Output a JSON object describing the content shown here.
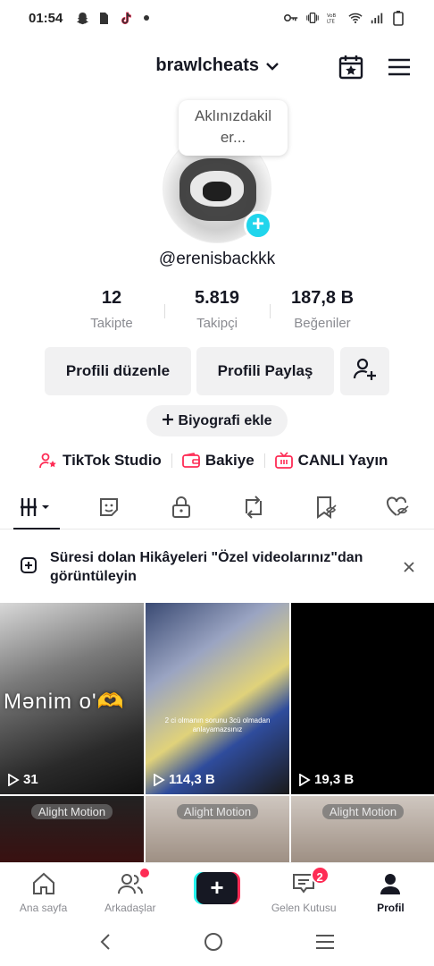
{
  "status_bar": {
    "time": "01:54",
    "left_icons": [
      "snapchat-icon",
      "sim-icon",
      "tiktok-icon",
      "dot-icon"
    ],
    "right_icons": [
      "key-icon",
      "vibrate-icon",
      "volte-icon",
      "wifi-icon",
      "signal-icon",
      "battery-icon"
    ]
  },
  "header": {
    "username": "brawlcheats",
    "icons": [
      "calendar-star-icon",
      "menu-icon"
    ]
  },
  "profile": {
    "bubble_text_line1": "Aklınızdakil",
    "bubble_text_line2": "er...",
    "handle": "@erenisbackkk",
    "stats": [
      {
        "value": "12",
        "label": "Takipte"
      },
      {
        "value": "5.819",
        "label": "Takipçi"
      },
      {
        "value": "187,8 B",
        "label": "Beğeniler"
      }
    ],
    "buttons": {
      "edit": "Profili düzenle",
      "share": "Profili Paylaş",
      "bio": "Biyografi ekle"
    },
    "links": [
      {
        "label": "TikTok Studio",
        "icon": "person-star-icon"
      },
      {
        "label": "Bakiye",
        "icon": "wallet-icon"
      },
      {
        "label": "CANLI Yayın",
        "icon": "live-tv-icon"
      }
    ]
  },
  "tabs": [
    "videos-grid-icon",
    "sticker-icon",
    "lock-icon",
    "repost-icon",
    "bookmark-hidden-icon",
    "heart-hidden-icon"
  ],
  "banner": {
    "text": "Süresi dolan Hikâyeleri \"Özel videolarınız\"dan görüntüleyin"
  },
  "videos": [
    {
      "views": "31",
      "caption": "Mənim o'🫶"
    },
    {
      "views": "114,3 B",
      "subtitle": "2 ci olmanın sorunu 3cü olmadan anlayamazsınız"
    },
    {
      "views": "19,3 B"
    },
    {
      "watermark": "Alight Motion"
    },
    {
      "watermark": "Alight Motion"
    },
    {
      "watermark": "Alight Motion"
    }
  ],
  "bottom_nav": [
    {
      "label": "Ana sayfa",
      "icon": "home-icon"
    },
    {
      "label": "Arkadaşlar",
      "icon": "friends-icon"
    },
    {
      "label": "",
      "icon": "create-icon"
    },
    {
      "label": "Gelen Kutusu",
      "icon": "inbox-icon",
      "badge": "2"
    },
    {
      "label": "Profil",
      "icon": "profile-icon"
    }
  ],
  "colors": {
    "accent": "#fe2c55",
    "cyan": "#20d5ec",
    "text": "#161823",
    "muted": "#8a8b91"
  }
}
